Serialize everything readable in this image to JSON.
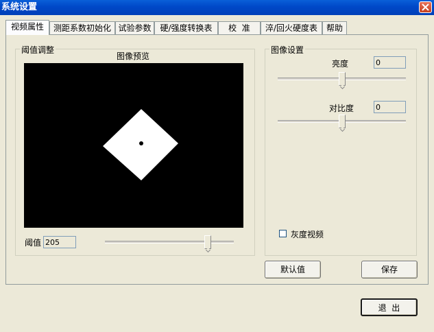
{
  "window": {
    "title": "系统设置"
  },
  "tabs": [
    "视频属性",
    "测距系数初始化",
    "试验参数",
    "硬/强度转换表",
    "校  准",
    "淬/回火硬度表",
    "帮助"
  ],
  "threshold": {
    "group_label": "阈值调整",
    "preview_label": "图像预览",
    "value_label": "阈值",
    "value": "205",
    "slider_level_percent": 80
  },
  "image_settings": {
    "group_label": "图像设置",
    "brightness_label": "亮度",
    "brightness_value": "0",
    "brightness_slider_percent": 50,
    "contrast_label": "对比度",
    "contrast_value": "0",
    "contrast_slider_percent": 50,
    "grayscale_label": "灰度视频",
    "grayscale_checked": false
  },
  "buttons": {
    "default": "默认值",
    "save": "保存",
    "exit": "退  出"
  },
  "colors": {
    "titlebar": "#0048c8",
    "preview_background": "#000000",
    "indent_shape": "#ffffff"
  }
}
